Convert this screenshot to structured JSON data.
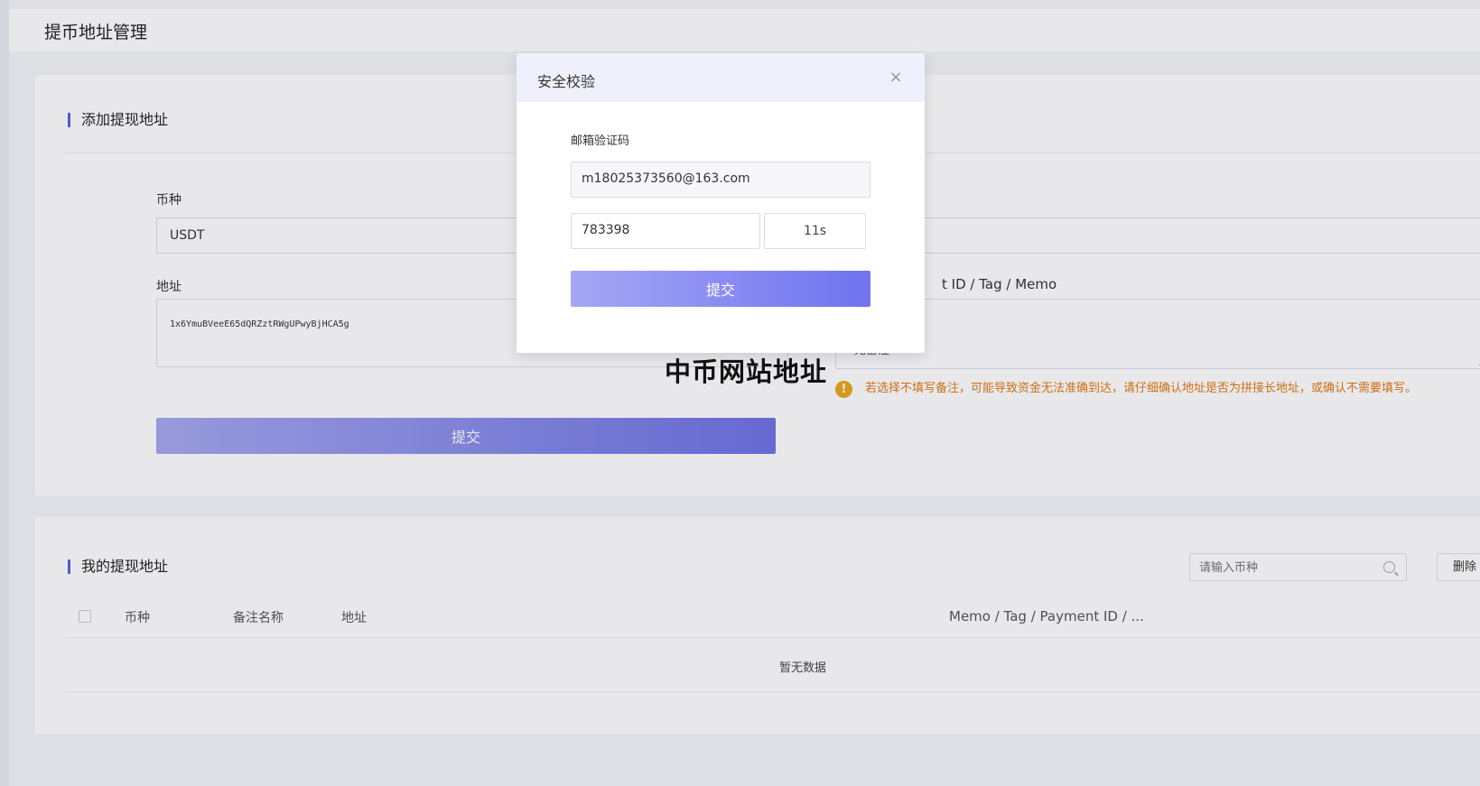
{
  "page": {
    "title": "提币地址管理"
  },
  "add_section": {
    "title": "添加提现地址",
    "currency_label": "币种",
    "currency_value": "USDT",
    "address_label": "地址",
    "address_value": "1x6YmuBVeeE65dQRZztRWgUPwyBjHCA5g",
    "memo_label_suffix": "t ID / Tag / Memo",
    "memo_placeholder_partial": "无备注",
    "submit_label": "提交",
    "warning_text": "若选择不填写备注，可能导致资金无法准确到达，请仔细确认地址是否为拼接长地址，或确认不需要填写。",
    "warning_icon": "!"
  },
  "list_section": {
    "title": "我的提现地址",
    "search_placeholder": "请输入币种",
    "delete_label": "删除",
    "columns": [
      "币种",
      "备注名称",
      "地址",
      "Memo / Tag / Payment ID / ..."
    ],
    "empty_text": "暂无数据"
  },
  "modal": {
    "title": "安全校验",
    "close_icon": "×",
    "email_label": "邮箱验证码",
    "email_value": "m18025373560@163.com",
    "code_value": "783398",
    "countdown": "11s",
    "submit_label": "提交"
  },
  "watermark": "中币网站地址"
}
